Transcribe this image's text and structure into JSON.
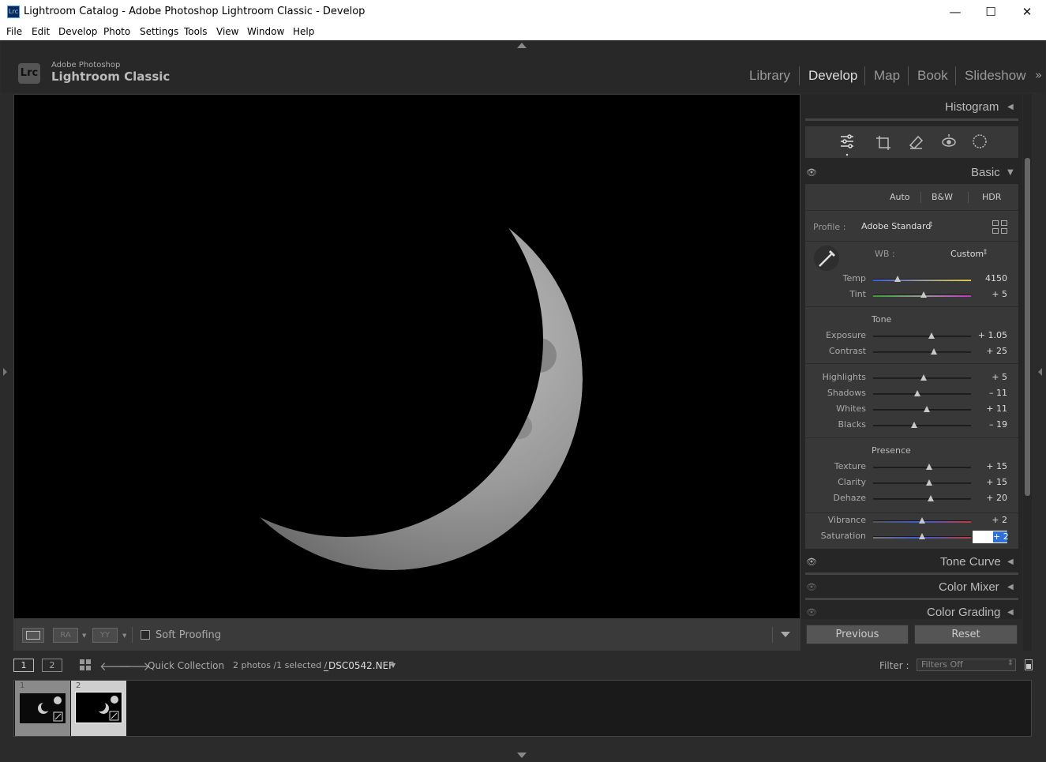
{
  "window": {
    "title": "Lightroom Catalog - Adobe Photoshop Lightroom Classic - Develop",
    "app_icon": "Lrc",
    "minimize": "—",
    "maximize": "☐",
    "close": "✕"
  },
  "menu": [
    "File",
    "Edit",
    "Develop",
    "Photo",
    "Settings",
    "Tools",
    "View",
    "Window",
    "Help"
  ],
  "identity": {
    "logo": "Lrc",
    "brand_top": "Adobe Photoshop",
    "brand_main": "Lightroom Classic"
  },
  "modules": [
    "Library",
    "Develop",
    "Map",
    "Book",
    "Slideshow"
  ],
  "active_module": "Develop",
  "toolbar": {
    "ra_label": "RA",
    "yy_label": "YY",
    "soft_proofing": "Soft Proofing"
  },
  "right_panel": {
    "histogram": "Histogram",
    "basic": "Basic",
    "treatment": [
      "Auto",
      "B&W",
      "HDR"
    ],
    "profile_label": "Profile :",
    "profile_value": "Adobe Standard",
    "wb_label": "WB :",
    "wb_value": "Custom",
    "tone_header": "Tone",
    "presence_header": "Presence",
    "sliders": [
      {
        "label": "Temp",
        "value": "4150",
        "pos": 0.25
      },
      {
        "label": "Tint",
        "value": "+ 5",
        "pos": 0.52
      },
      {
        "label": "Exposure",
        "value": "+ 1.05",
        "pos": 0.6
      },
      {
        "label": "Contrast",
        "value": "+ 25",
        "pos": 0.62
      },
      {
        "label": "Highlights",
        "value": "+ 5",
        "pos": 0.52
      },
      {
        "label": "Shadows",
        "value": "– 11",
        "pos": 0.45
      },
      {
        "label": "Whites",
        "value": "+ 11",
        "pos": 0.55
      },
      {
        "label": "Blacks",
        "value": "– 19",
        "pos": 0.42
      },
      {
        "label": "Texture",
        "value": "+ 15",
        "pos": 0.57
      },
      {
        "label": "Clarity",
        "value": "+ 15",
        "pos": 0.57
      },
      {
        "label": "Dehaze",
        "value": "+ 20",
        "pos": 0.59
      },
      {
        "label": "Vibrance",
        "value": "+ 2",
        "pos": 0.5
      },
      {
        "label": "Saturation",
        "value": "+ 2",
        "pos": 0.5
      }
    ],
    "tone_curve": "Tone Curve",
    "color_mixer": "Color Mixer",
    "color_grading": "Color Grading",
    "previous": "Previous",
    "reset": "Reset"
  },
  "filmstrip": {
    "view1": "1",
    "view2": "2",
    "source": "Quick Collection",
    "count": "2 photos /1 selected /",
    "filename": "_DSC0542.NEF",
    "filter_label": "Filter :",
    "filter_value": "Filters Off",
    "thumbs": [
      {
        "index": "1"
      },
      {
        "index": "2"
      }
    ]
  }
}
